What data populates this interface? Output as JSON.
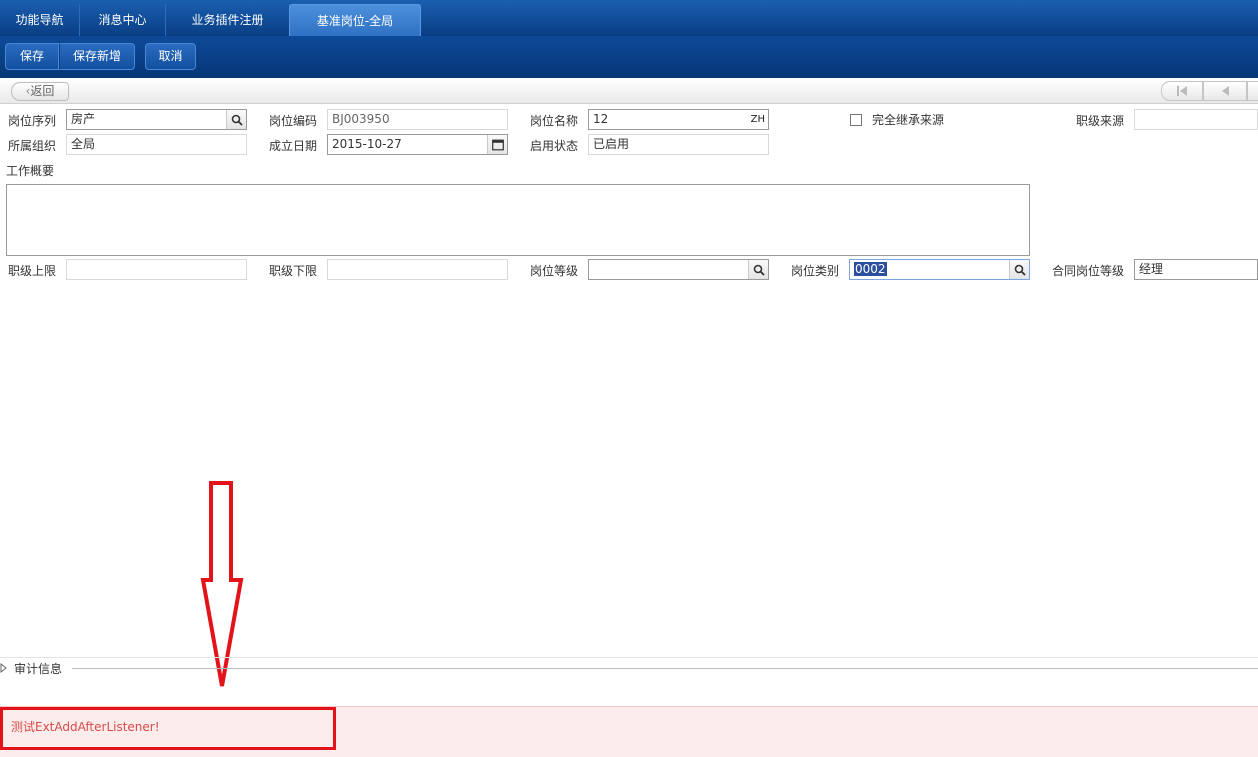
{
  "tabs": [
    {
      "label": "功能导航"
    },
    {
      "label": "消息中心"
    },
    {
      "label": "业务插件注册"
    },
    {
      "label": "基准岗位-全局"
    }
  ],
  "toolbar": {
    "save_label": "保存",
    "save_new_label": "保存新增",
    "cancel_label": "取消"
  },
  "nav": {
    "back_label": "返回"
  },
  "form": {
    "position_sequence": {
      "label": "岗位序列",
      "value": "房产"
    },
    "position_code": {
      "label": "岗位编码",
      "value": "BJ003950"
    },
    "position_name": {
      "label": "岗位名称",
      "value": "12",
      "lang_tag": "ZH"
    },
    "inherit_source": {
      "label": "完全继承来源"
    },
    "rank_source": {
      "label": "职级来源",
      "value": ""
    },
    "organization": {
      "label": "所属组织",
      "value": "全局"
    },
    "established_date": {
      "label": "成立日期",
      "value": "2015-10-27"
    },
    "enable_status": {
      "label": "启用状态",
      "value": "已启用"
    },
    "work_overview": {
      "label": "工作概要",
      "value": ""
    },
    "rank_upper": {
      "label": "职级上限",
      "value": ""
    },
    "rank_lower": {
      "label": "职级下限",
      "value": ""
    },
    "position_grade": {
      "label": "岗位等级",
      "value": ""
    },
    "position_category": {
      "label": "岗位类别",
      "value": "0002"
    },
    "contract_grade": {
      "label": "合同岗位等级",
      "value": "经理"
    }
  },
  "audit": {
    "label": "审计信息"
  },
  "message": {
    "text": "测试ExtAddAfterListener!"
  },
  "colors": {
    "tabbar": "#0a3f86",
    "active_tab": "#2f72c4",
    "annotation": "#e3131a",
    "message_bg": "#fcecec",
    "message_text": "#d84b4b"
  }
}
